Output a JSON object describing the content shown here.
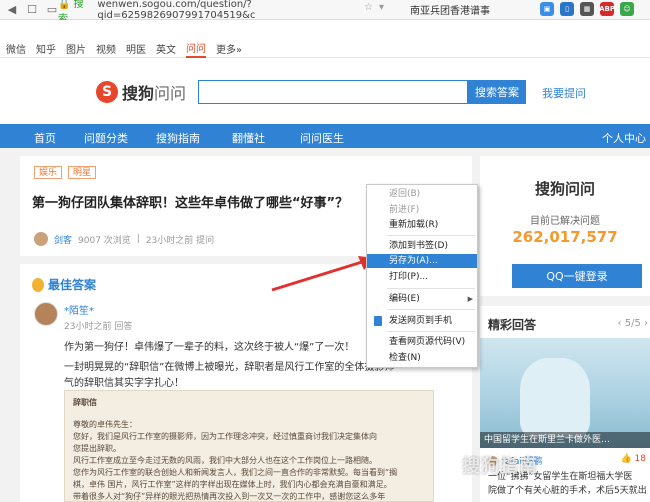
{
  "browser": {
    "url_host": "wenwen.sogou.com/question/?qid=6259826907991704519&c",
    "search_text": "南亚兵团香港谱事",
    "ext_abp": "ABP"
  },
  "toplinks": [
    "微信",
    "知乎",
    "图片",
    "视频",
    "明医",
    "英文",
    "问问",
    "更多»"
  ],
  "toplinks_active": "问问",
  "header": {
    "logo_main": "搜狗",
    "logo_sub": "问问",
    "search_button": "搜索答案",
    "ask_link": "我要提问"
  },
  "nav": {
    "items": [
      "首页",
      "问题分类",
      "搜狗指南",
      "翻懂社",
      "问问医生"
    ],
    "right": "个人中心"
  },
  "question": {
    "tags": [
      "娱乐",
      "明星"
    ],
    "title": "第一狗仔团队集体辞职！这些年卓伟做了哪些“好事”？",
    "user": "剑客",
    "views": "9007 次浏览",
    "time": "23小时之前 提问"
  },
  "answer": {
    "label": "最佳答案",
    "user": "*陌笙*",
    "time": "23小时之前 回答",
    "p1": "作为第一狗仔！卓伟爆了一辈子的料，这次终于被人“爆”了一次！",
    "p2": "一封明晃晃的“辞职信”在微博上被曝光，辞职者是风行工作室的全体摄影师",
    "p3": "气的辞职信其实字字扎心！",
    "letter_title": "辞职信",
    "letter_lines": [
      "尊敬的卓伟先生：",
      "您好，我们是风行工作室的摄影师，因为工作理念冲突，经过慎重商讨我们决定集体向",
      "您提出辞职。",
      "风行工作室成立至今走过无数的风雨，我们中大部分人也在这个工作岗位上一路相随。",
      "您作为风行工作室的联合创始人和新闻发言人，我们之间一直合作的非常默契。每当看到“搁",
      "棋，卓伟 国片，风行工作室”这样的字样出现在媒体上时，我们内心都会充满自豪和满足。",
      "带着很多人对“狗仔”异样的眼光把热情再次投入到一次又一次的工作中，感谢您这么多年"
    ]
  },
  "side": {
    "title": "搜狗问问",
    "subtitle": "目前已解决问题",
    "count": "262,017,577",
    "login_button": "QQ一键登录"
  },
  "hot": {
    "title": "精彩回答",
    "pager_prev": "‹",
    "pager": "5/5",
    "pager_next": "›",
    "caption": "中国留学生在斯里兰卡做外医…",
    "user": "fafaii邵鹏",
    "likes": "18",
    "text_1": "一位“狒狒”女留学生在斯坦福大学医",
    "text_2": "院做了个有关心脏的手术，术后5天就出"
  },
  "context_menu": {
    "items": [
      {
        "label": "返回(B)",
        "state": "disabled"
      },
      {
        "label": "前进(F)",
        "state": "disabled"
      },
      {
        "label": "重新加载(R)",
        "state": "normal"
      },
      {
        "label": "添加到书签(D)",
        "state": "normal"
      },
      {
        "label": "另存为(A)...",
        "state": "selected"
      },
      {
        "label": "打印(P)...",
        "state": "normal"
      },
      {
        "label": "编码(E)",
        "state": "normal"
      },
      {
        "label": "发送网页到手机",
        "state": "normal"
      },
      {
        "label": "查看网页源代码(V)",
        "state": "normal"
      },
      {
        "label": "检查(N)",
        "state": "normal"
      }
    ]
  },
  "watermark": "搜狗指南",
  "colors": {
    "brand_blue": "#2f82d4",
    "accent_orange": "#f29a2e",
    "logo_red": "#e8462a",
    "annotation_red": "#e03030"
  }
}
